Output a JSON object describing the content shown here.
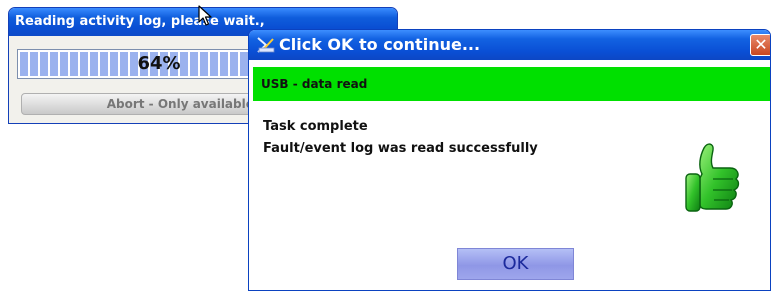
{
  "progress_dialog": {
    "title": "Reading activity log, please wait.",
    "title_tail": ",",
    "percent_label": "64%",
    "progress_fraction": 0.64,
    "abort_label": "Abort - Only available for ms"
  },
  "complete_dialog": {
    "title": "Click OK to continue...",
    "close_glyph": "✕",
    "status_banner": "USB - data read",
    "message_line1": "Task complete",
    "message_line2": "Fault/event log was read successfully",
    "ok_label": "OK",
    "icon": "thumbs-up-icon"
  },
  "colors": {
    "title_bar": "#0a50d6",
    "status_banner": "#00e000",
    "ok_button": "#9ea6ec",
    "thumb": "#22b522"
  }
}
